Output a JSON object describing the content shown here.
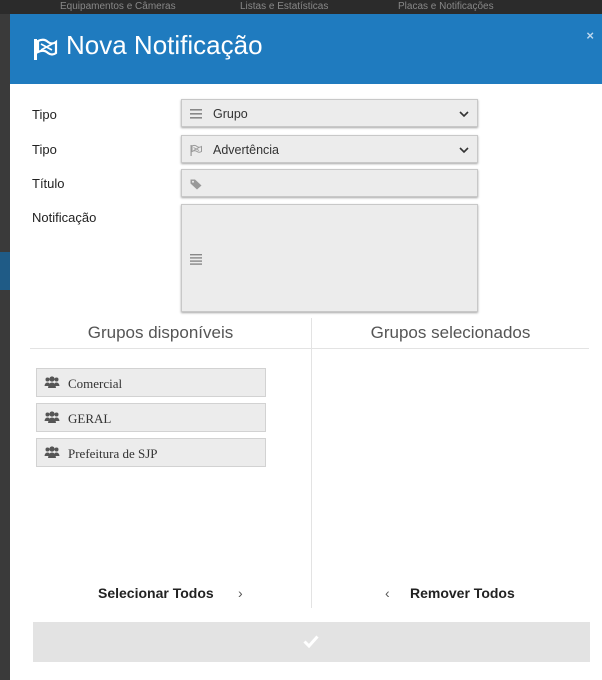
{
  "background": {
    "tabs": [
      "Equipamentos e Câmeras",
      "Listas e Estatísticas",
      "Placas e Notificações"
    ]
  },
  "modal": {
    "title": "Nova Notificação",
    "close": "×",
    "header_color": "#1f7bbf"
  },
  "form": {
    "tipo1": {
      "label": "Tipo",
      "value": "Grupo",
      "icon": "list-icon"
    },
    "tipo2": {
      "label": "Tipo",
      "value": "Advertência",
      "icon": "flag-icon"
    },
    "titulo": {
      "label": "Título",
      "value": "",
      "icon": "tag-icon"
    },
    "notificacao": {
      "label": "Notificação",
      "value": "",
      "icon": "align-justify-icon"
    }
  },
  "groups": {
    "available_title": "Grupos disponíveis",
    "selected_title": "Grupos selecionados",
    "available": [
      {
        "label": "Comercial",
        "icon": "users-icon"
      },
      {
        "label": "GERAL",
        "icon": "users-icon"
      },
      {
        "label": "Prefeitura de SJP",
        "icon": "users-icon"
      }
    ],
    "selected": [],
    "select_all": "Selecionar Todos",
    "select_all_chevron": "›",
    "remove_all": "Remover Todos",
    "remove_all_chevron": "‹"
  },
  "submit": {
    "icon": "check-icon"
  }
}
